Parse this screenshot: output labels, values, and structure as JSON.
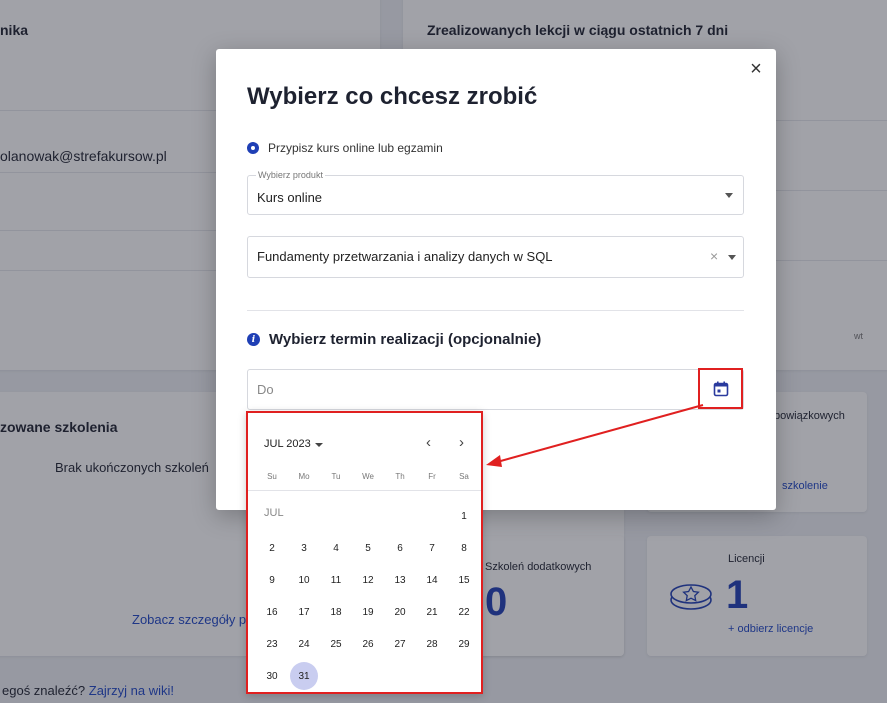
{
  "background": {
    "card1_title": "nika",
    "email": "olanowak@strefakursow.pl",
    "card2_title": "Zrealizowanych lekcji w ciągu ostatnich 7 dni",
    "chart_label": "wt",
    "card3_title": "zowane szkolenia",
    "no_trainings": "Brak ukończonych szkoleń",
    "details_link": "Zobacz szczegóły pr",
    "mandatory_title": "bowiązkowych",
    "mandatory_link": "szkolenie",
    "extra_title": "Szkoleń dodatkowych",
    "extra_count": "0",
    "licenses_title": "Licencji",
    "licenses_count": "1",
    "licenses_link": "+ odbierz licencje",
    "footer_question": "egoś znaleźć?",
    "footer_link": "Zajrzyj na wiki!"
  },
  "modal": {
    "title": "Wybierz co chcesz zrobić",
    "close_symbol": "×",
    "radio_label": "Przypisz kurs online lub egzamin",
    "product_label": "Wybierz produkt",
    "product_value": "Kurs online",
    "course_value": "Fundamenty przetwarzania i analizy danych w SQL",
    "clear_symbol": "×",
    "date_section_title": "Wybierz termin realizacji (opcjonalnie)",
    "date_placeholder": "Do"
  },
  "calendar": {
    "month_year": "JUL 2023",
    "prev_symbol": "‹",
    "next_symbol": "›",
    "weekdays": [
      "Su",
      "Mo",
      "Tu",
      "We",
      "Th",
      "Fr",
      "Sa"
    ],
    "month_short": "JUL",
    "days": [
      "1",
      "2",
      "3",
      "4",
      "5",
      "6",
      "7",
      "8",
      "9",
      "10",
      "11",
      "12",
      "13",
      "14",
      "15",
      "16",
      "17",
      "18",
      "19",
      "20",
      "21",
      "22",
      "23",
      "24",
      "25",
      "26",
      "27",
      "28",
      "29",
      "30",
      "31"
    ],
    "selected_day": "31"
  },
  "icons": {
    "calendar_icon": "calendar-icon",
    "info_icon": "info-icon",
    "license_icon": "coins-icon"
  },
  "colors": {
    "accent": "#1f3fb5",
    "highlight": "#e02020",
    "selected_day_bg": "#c9cdf0"
  }
}
